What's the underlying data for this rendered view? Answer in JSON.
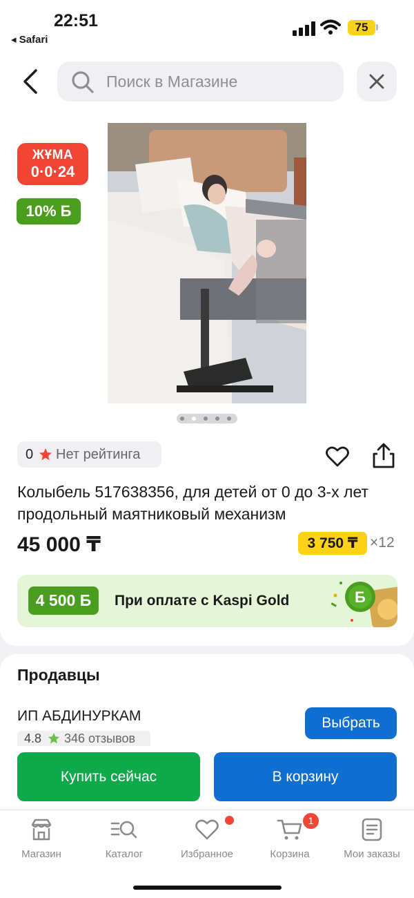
{
  "status_bar": {
    "time": "22:51",
    "back_app": "◂ Safari",
    "battery": "75"
  },
  "search": {
    "placeholder": "Поиск в Магазине"
  },
  "badges": {
    "juma_line1": "ЖҰМА",
    "juma_line2": "0·0·24",
    "bonus": "10% Б"
  },
  "gallery": {
    "total_images": 5,
    "active_index": 1
  },
  "rating": {
    "value": "0",
    "text": "Нет рейтинга"
  },
  "product": {
    "title": "Колыбель 517638356, для детей от 0 до 3-х лет продольный маятниковый механизм",
    "price": "45 000 ₸",
    "installment_amount": "3 750 ₸",
    "installment_months": "×12"
  },
  "kaspi_gold": {
    "bonus": "4 500 Б",
    "text": "При оплате с Kaspi Gold"
  },
  "sellers": {
    "title": "Продавцы",
    "seller_name": "ИП АБДИНУРКАМ",
    "seller_rating": "4.8",
    "seller_reviews": "346 отзывов",
    "choose_label": "Выбрать"
  },
  "actions": {
    "buy_now": "Купить сейчас",
    "add_to_cart": "В корзину"
  },
  "tabbar": {
    "items": [
      {
        "label": "Магазин",
        "icon": "shop-icon"
      },
      {
        "label": "Каталог",
        "icon": "catalog-icon"
      },
      {
        "label": "Избранное",
        "icon": "heart-icon"
      },
      {
        "label": "Корзина",
        "icon": "cart-icon"
      },
      {
        "label": "Мои заказы",
        "icon": "orders-icon"
      }
    ],
    "cart_count": "1"
  },
  "colors": {
    "red": "#f14635",
    "green": "#4a9d1f",
    "blue": "#0f6fd0",
    "buy_green": "#0fa84a",
    "yellow": "#fcd116"
  }
}
